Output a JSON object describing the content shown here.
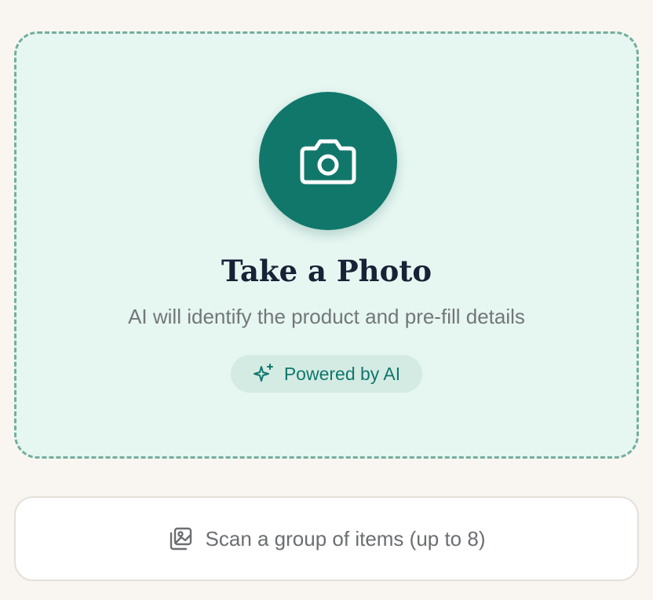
{
  "photo_card": {
    "icon": "camera-icon",
    "title": "Take a Photo",
    "subtitle": "AI will identify the product and pre-fill details",
    "badge": {
      "icon": "sparkles-icon",
      "label": "Powered by AI"
    }
  },
  "scan_group_button": {
    "icon": "image-gallery-icon",
    "label": "Scan a group of items (up to 8)"
  },
  "colors": {
    "background": "#f9f6f1",
    "card_fill": "#e6f6f1",
    "card_dashed_border": "#76ad9e",
    "accent": "#11776b",
    "title": "#172236",
    "muted_text": "#727779",
    "badge_fill": "#d4ebe4"
  }
}
